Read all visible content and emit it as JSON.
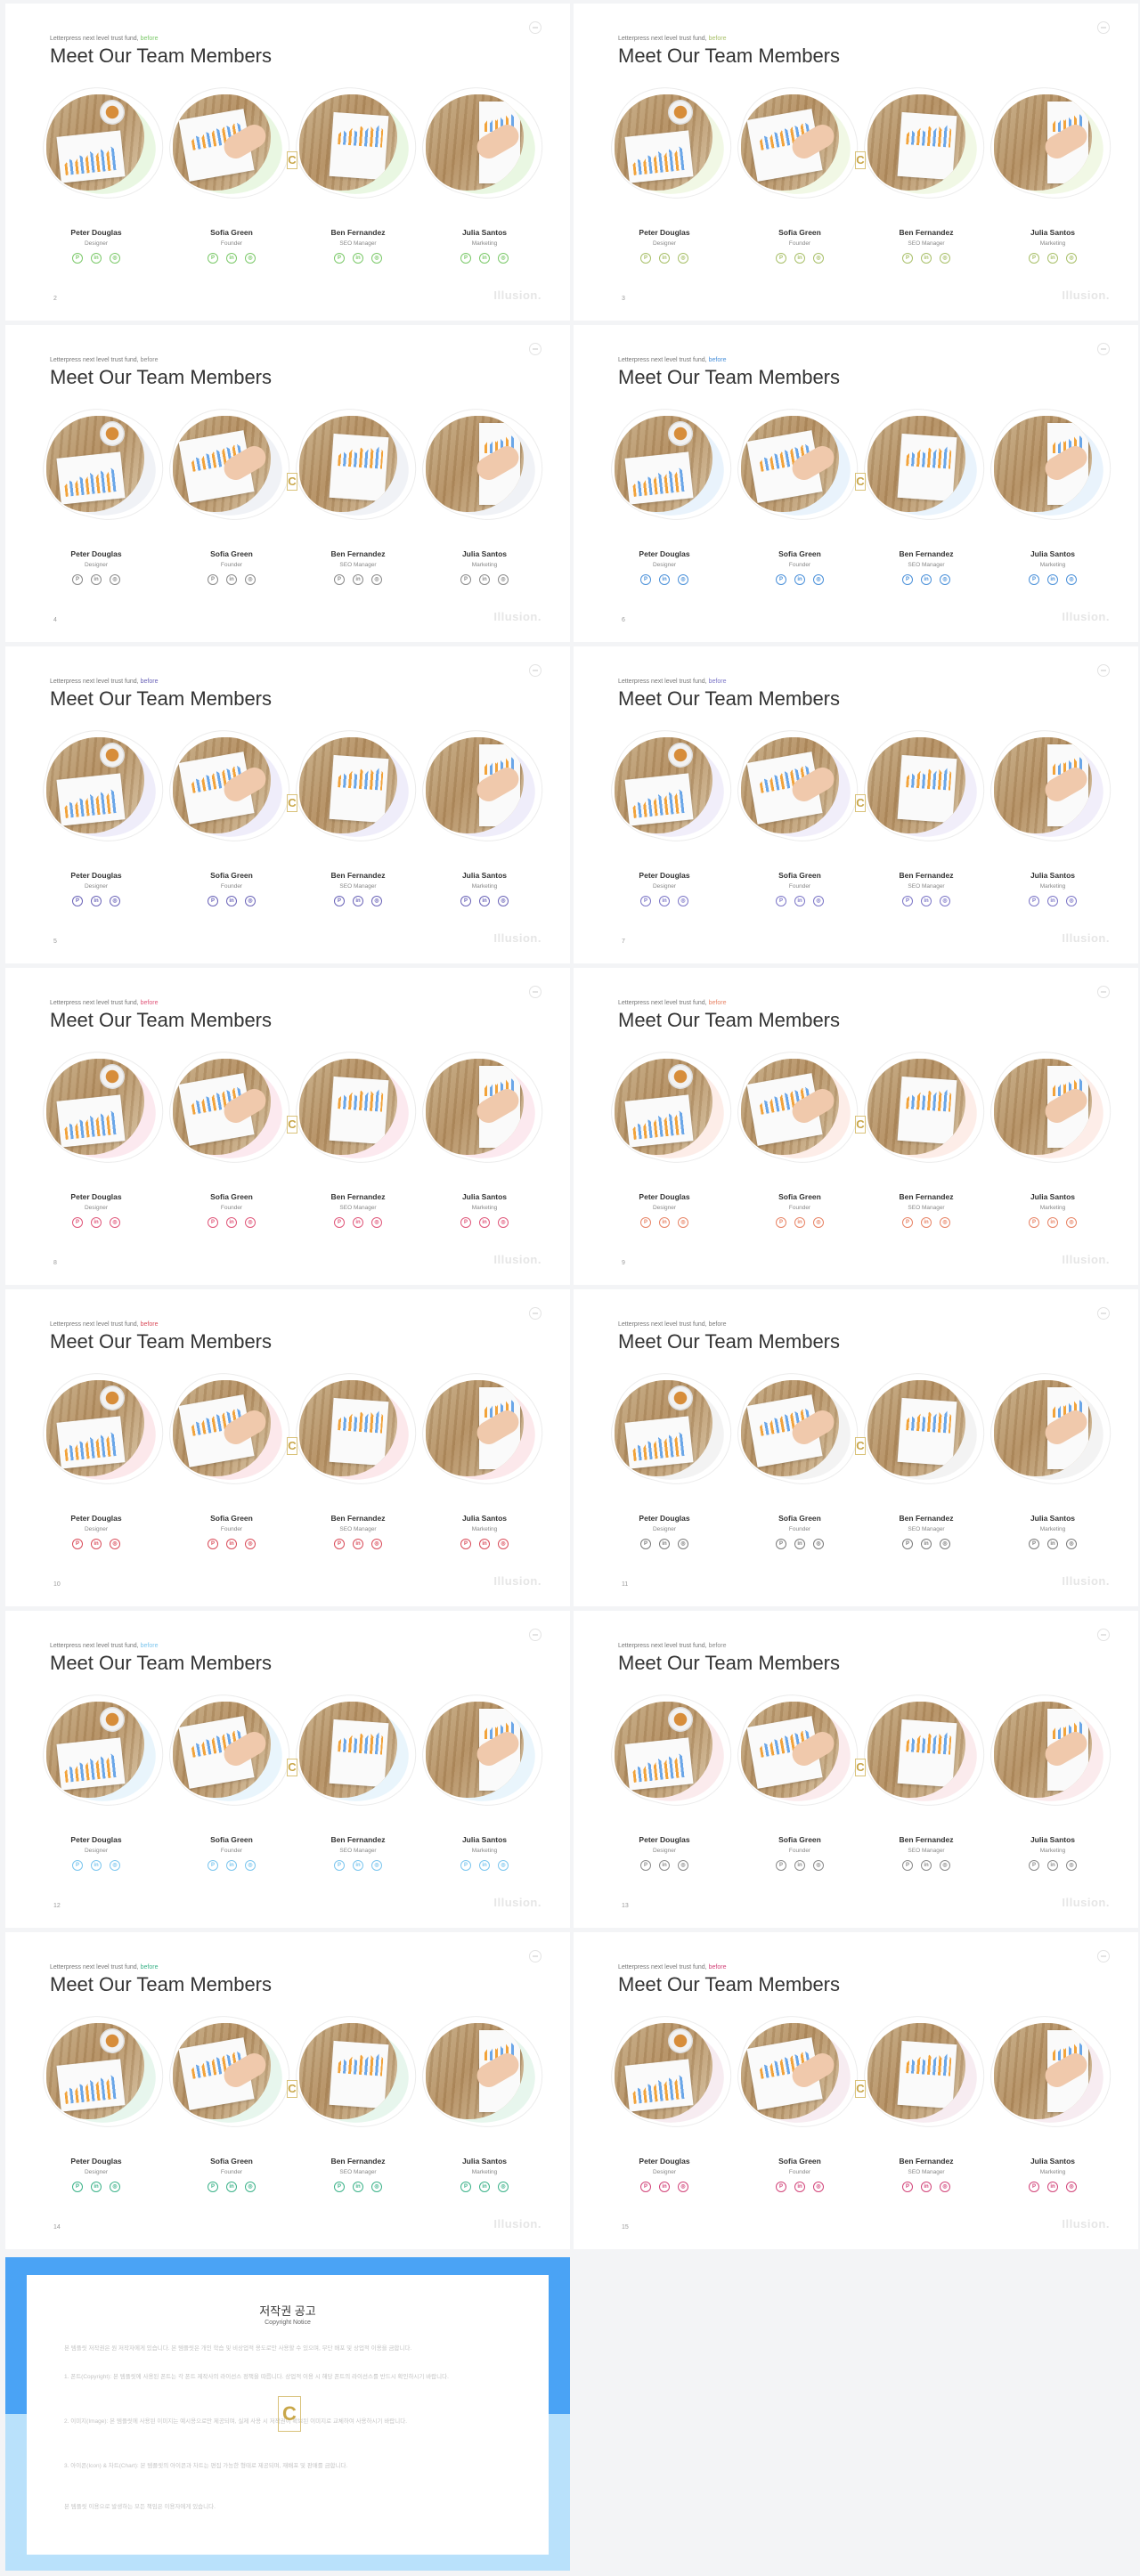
{
  "slide_content": {
    "subtitle": "Letterpress next level trust fund,",
    "subtitle_accent": "before",
    "title": "Meet Our Team Members",
    "logo": "Illusion.",
    "members": [
      {
        "name": "Peter Douglas",
        "role": "Designer"
      },
      {
        "name": "Sofia Green",
        "role": "Founder"
      },
      {
        "name": "Ben  Fernandez",
        "role": "SEO Manager"
      },
      {
        "name": "Julia Santos",
        "role": "Marketing"
      }
    ],
    "social_icons": [
      "pinterest-icon",
      "linkedin-icon",
      "instagram-icon"
    ],
    "social_glyphs": [
      "P",
      "in",
      "◎"
    ]
  },
  "slides": [
    {
      "page": "2",
      "accent": "#7cc96a",
      "glow": "#cfeebf"
    },
    {
      "page": "3",
      "accent": "#a9c06a",
      "glow": "#dff0c6"
    },
    {
      "page": "4",
      "accent": "#8a8a8a",
      "glow": "#dde3ea"
    },
    {
      "page": "6",
      "accent": "#4a90d9",
      "glow": "#cfe4f8"
    },
    {
      "page": "5",
      "accent": "#6b64b8",
      "glow": "#dcd8f3"
    },
    {
      "page": "7",
      "accent": "#7c76c7",
      "glow": "#dfdaf5"
    },
    {
      "page": "8",
      "accent": "#e0577a",
      "glow": "#f9cfdb"
    },
    {
      "page": "9",
      "accent": "#e88466",
      "glow": "#fbd8cc"
    },
    {
      "page": "10",
      "accent": "#d94c5a",
      "glow": "#f8cdd2"
    },
    {
      "page": "11",
      "accent": "#7b7b7b",
      "glow": "#e4e4e4"
    },
    {
      "page": "12",
      "accent": "#7cc6ee",
      "glow": "#cfe9f8"
    },
    {
      "page": "13",
      "accent": "#8c8c8c",
      "glow": "#f6d2d8"
    },
    {
      "page": "14",
      "accent": "#3db38a",
      "glow": "#c9ecd6"
    },
    {
      "page": "15",
      "accent": "#d2457a",
      "glow": "#eed5e0"
    }
  ],
  "copyright": {
    "title": "저작권 공고",
    "subtitle": "Copyright Notice",
    "paragraphs": [
      "본 템플릿 저작권은 원 저작자에게 있습니다. 본 템플릿은 개인 학습 및 비상업적 용도로만 사용할 수 있으며, 무단 배포 및 상업적 이용을 금합니다.",
      "1. 폰트(Copyright): 본 템플릿에 사용된 폰트는 각 폰트 제작사의 라이선스 정책을 따릅니다. 상업적 이용 시 해당 폰트의 라이선스를 반드시 확인하시기 바랍니다.",
      "2. 이미지(Image): 본 템플릿에 사용된 이미지는 예시용으로만 제공되며, 실제 사용 시 저작권이 확보된 이미지로 교체하여 사용하시기 바랍니다.",
      "3. 아이콘(Icon) & 차트(Chart): 본 템플릿의 아이콘과 차트는 편집 가능한 형태로 제공되며, 재배포 및 판매를 금합니다.",
      "본 템플릿 이용으로 발생하는 모든 책임은 이용자에게 있습니다."
    ]
  }
}
